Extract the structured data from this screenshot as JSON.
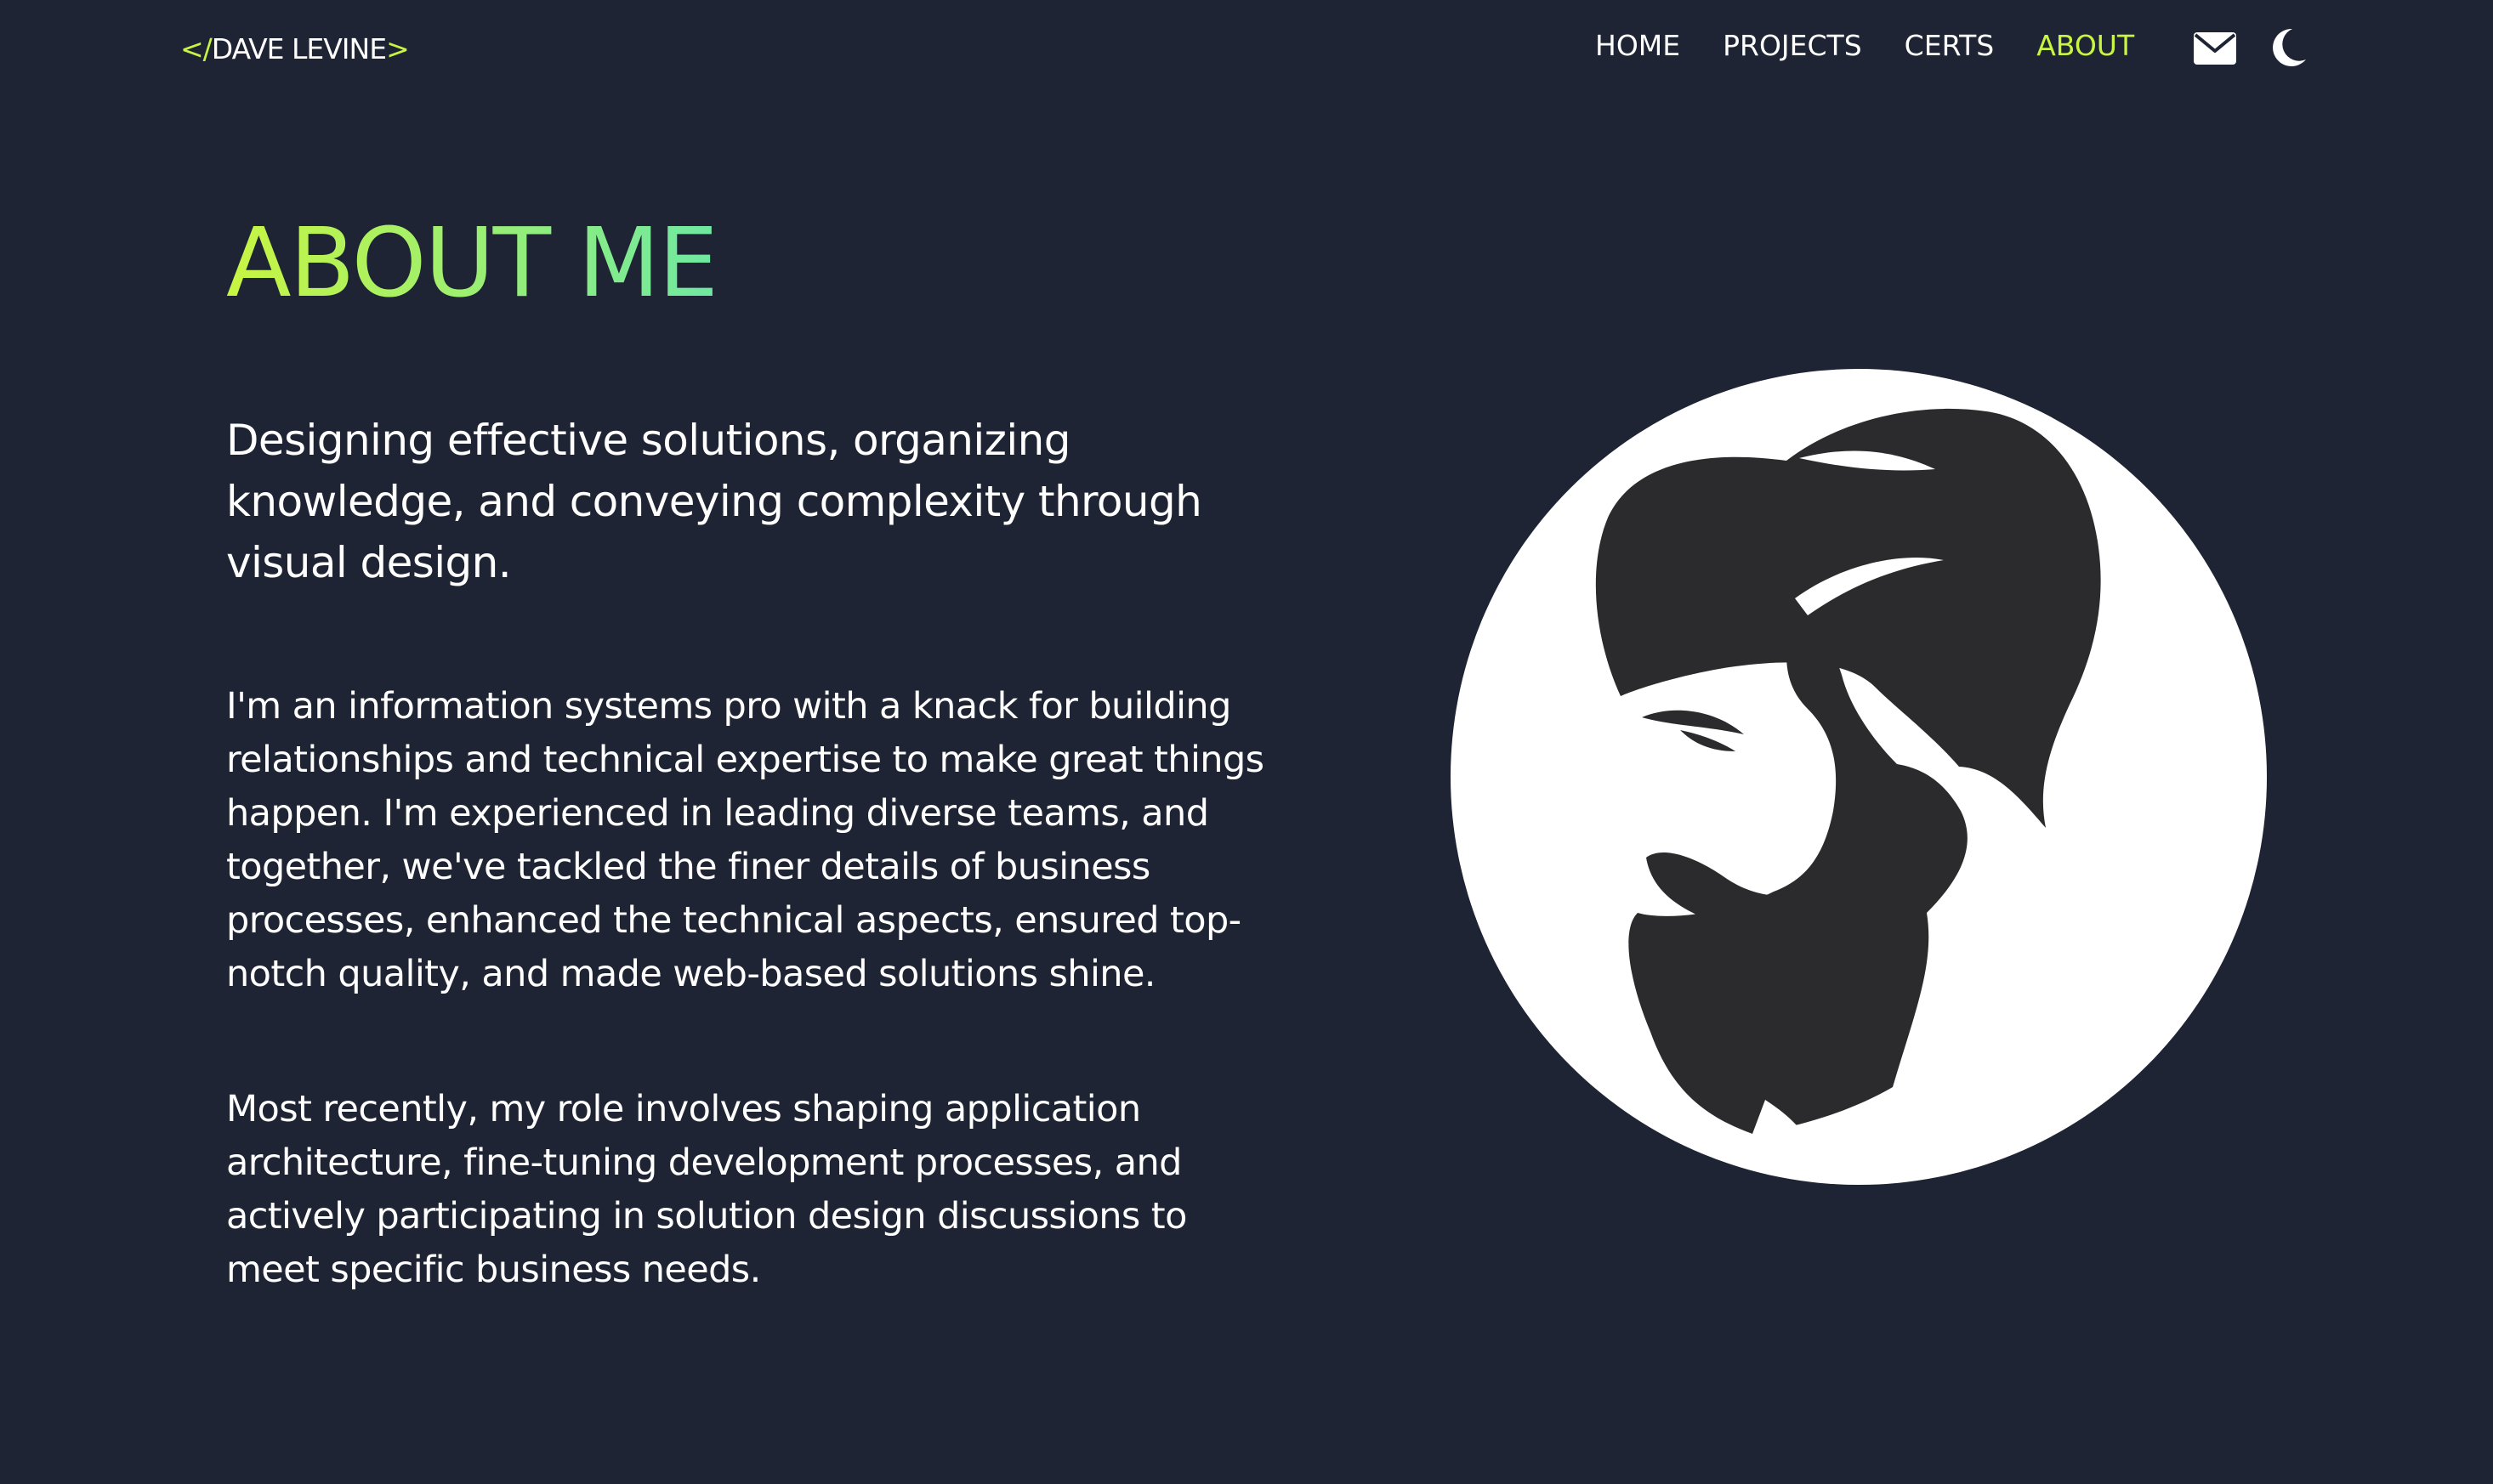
{
  "header": {
    "logo_open": "</",
    "logo_name": "DAVE LEVINE",
    "logo_close": ">",
    "nav": [
      {
        "label": "HOME",
        "active": false
      },
      {
        "label": "PROJECTS",
        "active": false
      },
      {
        "label": "CERTS",
        "active": false
      },
      {
        "label": "ABOUT",
        "active": true
      }
    ],
    "icons": [
      "mail-icon",
      "moon-icon"
    ]
  },
  "main": {
    "title": "ABOUT ME",
    "lead": "Designing effective solutions, organizing knowledge, and conveying complexity through visual design.",
    "paragraphs": [
      "I'm an information systems pro with a knack for building relationships and technical expertise to make great things happen. I'm experienced in leading diverse teams, and together, we've tackled the finer details of business processes, enhanced the technical aspects, ensured top-notch quality, and made web-based solutions shine.",
      "Most recently, my role involves shaping application architecture, fine-tuning development processes, and actively participating in solution design discussions to meet specific business needs."
    ],
    "avatar_icon": "bearded-man-silhouette"
  },
  "colors": {
    "background": "#1e2433",
    "accent": "#c8f542",
    "title_gradient_end": "#6fe8a2",
    "text": "#ffffff",
    "silhouette": "#2b2b2d"
  }
}
